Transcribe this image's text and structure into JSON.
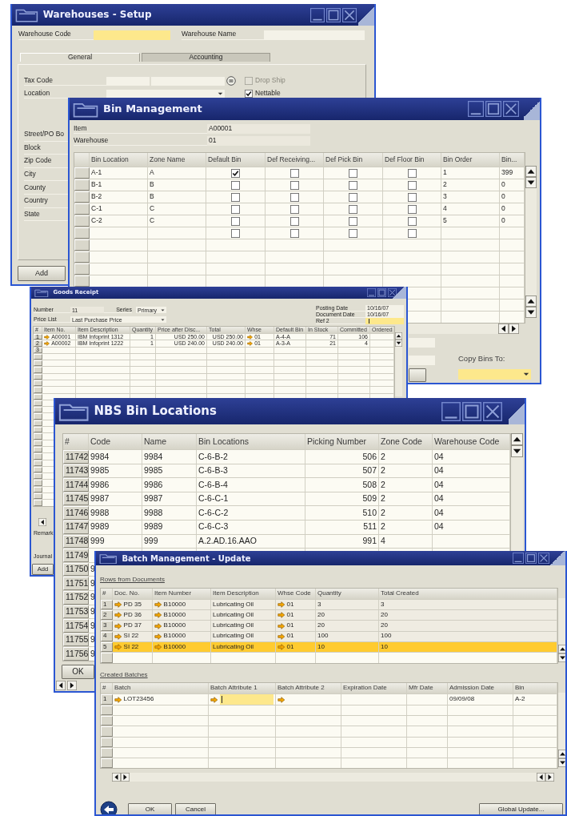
{
  "warehouses_setup": {
    "title": "Warehouses - Setup",
    "header_fields": [
      {
        "label": "Warehouse Code",
        "highlighted": true
      },
      {
        "label": "Warehouse Name",
        "highlighted": false
      }
    ],
    "tabs": [
      {
        "label": "General",
        "selected": true
      },
      {
        "label": "Accounting",
        "selected": false
      }
    ],
    "fields": [
      {
        "label": "Tax Code",
        "kind": "lookup"
      },
      {
        "label": "Location",
        "kind": "dropdown"
      }
    ],
    "checkboxes": [
      {
        "label": "Drop Ship",
        "checked": false,
        "disabled": true
      },
      {
        "label": "Nettable",
        "checked": true,
        "disabled": false
      }
    ],
    "address_labels": [
      "Street/PO Bo",
      "Block",
      "Zip Code",
      "City",
      "County",
      "Country",
      "State"
    ],
    "button": "Add"
  },
  "bin_management": {
    "title": "Bin Management",
    "fields": [
      {
        "label": "Item",
        "value": "A00001"
      },
      {
        "label": "Warehouse",
        "value": "01"
      }
    ],
    "columns": [
      "Bin Location",
      "Zone Name",
      "Default Bin",
      "Def Receiving...",
      "Def Pick Bin",
      "Def Floor Bin",
      "Bin Order",
      "Bin..."
    ],
    "rows": [
      {
        "bin_location": "A-1",
        "zone_name": "A",
        "default_bin": true,
        "def_receiving": false,
        "def_pick": false,
        "def_floor": false,
        "bin_order": "1",
        "bin": "399"
      },
      {
        "bin_location": "B-1",
        "zone_name": "B",
        "default_bin": false,
        "def_receiving": false,
        "def_pick": false,
        "def_floor": false,
        "bin_order": "2",
        "bin": "0"
      },
      {
        "bin_location": "B-2",
        "zone_name": "B",
        "default_bin": false,
        "def_receiving": false,
        "def_pick": false,
        "def_floor": false,
        "bin_order": "3",
        "bin": "0"
      },
      {
        "bin_location": "C-1",
        "zone_name": "C",
        "default_bin": false,
        "def_receiving": false,
        "def_pick": false,
        "def_floor": false,
        "bin_order": "4",
        "bin": "0"
      },
      {
        "bin_location": "C-2",
        "zone_name": "C",
        "default_bin": false,
        "def_receiving": false,
        "def_pick": false,
        "def_floor": false,
        "bin_order": "5",
        "bin": "0"
      },
      {
        "default_bin": false,
        "def_receiving": false,
        "def_pick": false,
        "def_floor": false
      }
    ],
    "copy_bins_label": "Copy Bins To:"
  },
  "goods_receipt": {
    "title": "Goods Receipt",
    "number_label": "Number",
    "number": "11",
    "series_label": "Series",
    "series": "Primary",
    "price_list_label": "Price List",
    "price_list": "Last Purchase Price",
    "dates": [
      {
        "label": "Posting Date",
        "value": "10/16/07",
        "highlighted": false
      },
      {
        "label": "Document Date",
        "value": "10/16/07",
        "highlighted": false
      },
      {
        "label": "Ref 2",
        "highlighted": true
      }
    ],
    "columns": [
      "#",
      "Item No.",
      "Item Description",
      "Quantity",
      "Price after Disc...",
      "Total",
      "Whse",
      "Default Bin",
      "In Stock",
      "Committed",
      "Ordered"
    ],
    "rows": [
      {
        "number": "1",
        "item_no": "A00001",
        "description": "IBM Infoprint 1312",
        "quantity": "1",
        "price": "USD 250.00",
        "total": "USD 250.00",
        "whse": "01",
        "default_bin": "A-4-A",
        "in_stock": "71",
        "committed": "106"
      },
      {
        "number": "2",
        "item_no": "A00002",
        "description": "IBM Infoprint 1222",
        "quantity": "1",
        "price": "USD 240.00",
        "total": "USD 240.00",
        "whse": "01",
        "default_bin": "A-3-A",
        "in_stock": "21",
        "committed": "4"
      },
      {
        "number": "3"
      }
    ],
    "footer_labels": [
      "Remark",
      "Journal"
    ],
    "button": "Add"
  },
  "nbs_bin_locations": {
    "title": "NBS Bin Locations",
    "columns": [
      "#",
      "Code",
      "Name",
      "Bin Locations",
      "Picking Number",
      "Zone Code",
      "Warehouse Code"
    ],
    "rows": [
      {
        "number": "11742",
        "code": "9984",
        "name": "9984",
        "bin_locations": "C-6-B-2",
        "picking_number": "506",
        "zone_code": "2",
        "warehouse_code": "04"
      },
      {
        "number": "11743",
        "code": "9985",
        "name": "9985",
        "bin_locations": "C-6-B-3",
        "picking_number": "507",
        "zone_code": "2",
        "warehouse_code": "04"
      },
      {
        "number": "11744",
        "code": "9986",
        "name": "9986",
        "bin_locations": "C-6-B-4",
        "picking_number": "508",
        "zone_code": "2",
        "warehouse_code": "04"
      },
      {
        "number": "11745",
        "code": "9987",
        "name": "9987",
        "bin_locations": "C-6-C-1",
        "picking_number": "509",
        "zone_code": "2",
        "warehouse_code": "04"
      },
      {
        "number": "11746",
        "code": "9988",
        "name": "9988",
        "bin_locations": "C-6-C-2",
        "picking_number": "510",
        "zone_code": "2",
        "warehouse_code": "04"
      },
      {
        "number": "11747",
        "code": "9989",
        "name": "9989",
        "bin_locations": "C-6-C-3",
        "picking_number": "511",
        "zone_code": "2",
        "warehouse_code": "04"
      },
      {
        "number": "11748",
        "code": "999",
        "name": "999",
        "bin_locations": "A.2.AD.16.AAO",
        "picking_number": "991",
        "zone_code": "4"
      },
      {
        "number": "11749"
      },
      {
        "number": "11750",
        "code": "9"
      },
      {
        "number": "11751",
        "code": "9"
      },
      {
        "number": "11752",
        "code": "9"
      },
      {
        "number": "11753",
        "code": "9"
      },
      {
        "number": "11754",
        "code": "9"
      },
      {
        "number": "11755",
        "code": "9"
      },
      {
        "number": "11756",
        "code": "9"
      }
    ],
    "button": "OK"
  },
  "batch_management": {
    "title": "Batch Management - Update",
    "documents_label": "Rows from Documents",
    "documents_columns": [
      "#",
      "Doc. No.",
      "Item Number",
      "Item Description",
      "Whse Code",
      "Quantity",
      "Total Created"
    ],
    "documents": [
      {
        "number": "1",
        "doc_no": "PD 35",
        "item_number": "B10000",
        "item_description": "Lubricating Oil",
        "whse_code": "01",
        "quantity": "3",
        "total_created": "3",
        "selected": false
      },
      {
        "number": "2",
        "doc_no": "PD 36",
        "item_number": "B10000",
        "item_description": "Lubricating Oil",
        "whse_code": "01",
        "quantity": "20",
        "total_created": "20",
        "selected": false
      },
      {
        "number": "3",
        "doc_no": "PD 37",
        "item_number": "B10000",
        "item_description": "Lubricating Oil",
        "whse_code": "01",
        "quantity": "20",
        "total_created": "20",
        "selected": false
      },
      {
        "number": "4",
        "doc_no": "SI 22",
        "item_number": "B10000",
        "item_description": "Lubricating Oil",
        "whse_code": "01",
        "quantity": "100",
        "total_created": "100",
        "selected": false
      },
      {
        "number": "5",
        "doc_no": "SI 22",
        "item_number": "B10000",
        "item_description": "Lubricating Oil",
        "whse_code": "01",
        "quantity": "10",
        "total_created": "10",
        "selected": true
      }
    ],
    "batches_label": "Created Batches",
    "batches_columns": [
      "#",
      "Batch",
      "Batch Attribute 1",
      "Batch Attribute 2",
      "Expiration Date",
      "Mfr Date",
      "Admission Date",
      "Bin"
    ],
    "batches": [
      {
        "number": "1",
        "batch": "LOT23456",
        "admission_date": "09/09/08",
        "bin": "A-2"
      }
    ],
    "buttons": [
      "OK",
      "Cancel",
      "Global Update..."
    ]
  }
}
